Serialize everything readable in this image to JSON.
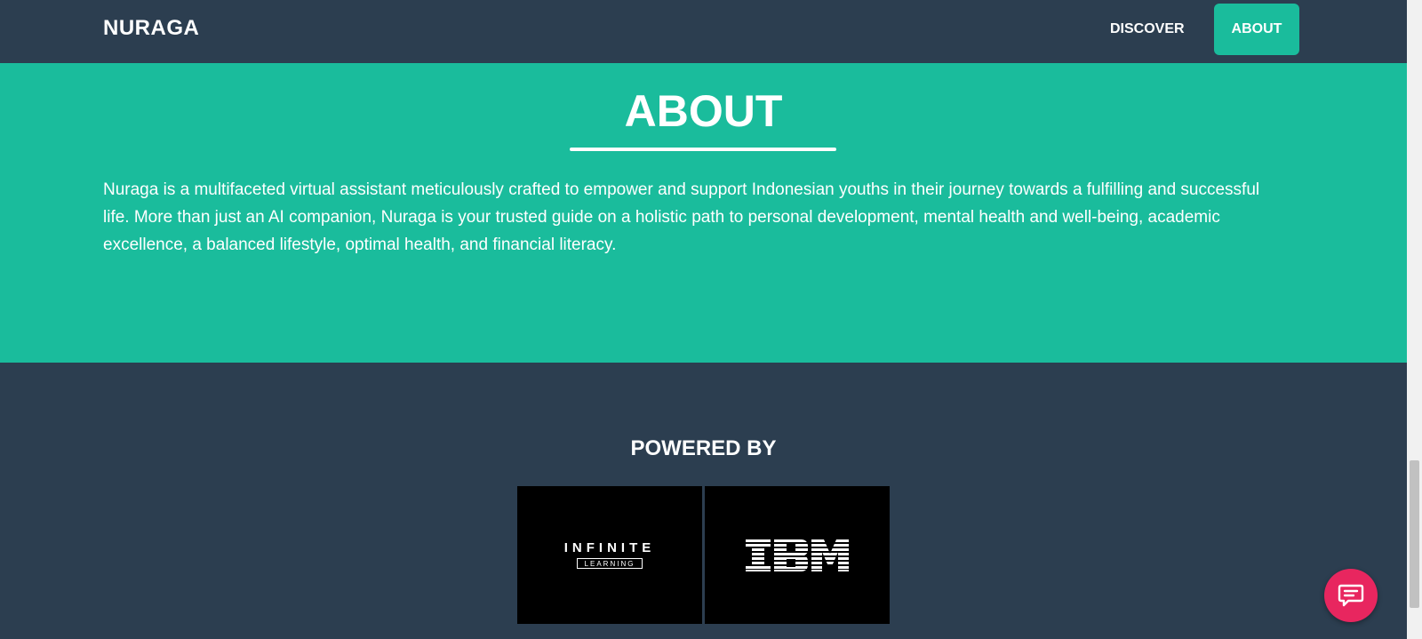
{
  "navbar": {
    "brand": "NURAGA",
    "links": [
      {
        "label": "DISCOVER",
        "active": false
      },
      {
        "label": "ABOUT",
        "active": true
      }
    ]
  },
  "about": {
    "title": "ABOUT",
    "description": "Nuraga is a multifaceted virtual assistant meticulously crafted to empower and support Indonesian youths in their journey towards a fulfilling and successful life. More than just an AI companion, Nuraga is your trusted guide on a holistic path to personal development, mental health and well-being, academic excellence, a balanced lifestyle, optimal health, and financial literacy."
  },
  "powered_by": {
    "title": "POWERED BY",
    "logos": [
      {
        "name": "INFINITE",
        "subtext": "LEARNING"
      },
      {
        "name": "IBM"
      }
    ]
  },
  "chat_button": {
    "icon": "chat-icon"
  },
  "colors": {
    "navbar_bg": "#2c3e50",
    "accent": "#1abc9c",
    "chat_button": "#e8265f"
  }
}
